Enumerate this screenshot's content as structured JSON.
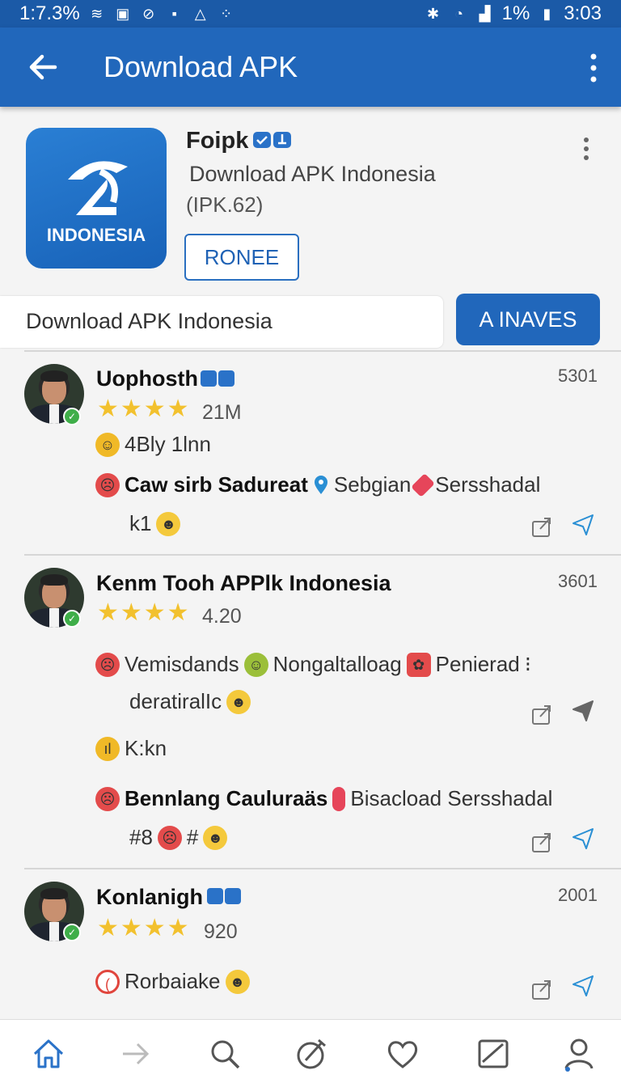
{
  "status_bar": {
    "left_text": "1:7.3%",
    "battery": "1%",
    "time": "3:03"
  },
  "app_bar": {
    "title": "Download APK"
  },
  "app_card": {
    "icon_label": "INDONESIA",
    "name": "Foipk",
    "subtitle": "Download APK Indonesia",
    "version": "(IPK.62)",
    "button_label": "RONEE"
  },
  "search": {
    "value": "Download APK Indonesia",
    "button_label": "A INAVES"
  },
  "posts": [
    {
      "name": "Uophosth",
      "count": "5301",
      "rating": "21M",
      "meta": "4Bly 1lnn",
      "line_bold": "Caw sirb Sadureat",
      "tag1": "Sebgian",
      "tag2": "Sersshadal",
      "reaction": "k1"
    },
    {
      "name": "Kenm Tooh APPlk Indonesia",
      "count": "3601",
      "rating": "4.20",
      "line1_a": "Vemisdands",
      "line1_b": "Nongaltalloag",
      "line1_c": "Penierad",
      "line2": "deratiralIc",
      "meta": "K:kn",
      "line3_bold": "Bennlang Cauluraäs",
      "line3_rest": "Bisacload Sersshadal",
      "reaction_a": "#8",
      "reaction_b": "#"
    },
    {
      "name": "Konlanigh",
      "count": "2001",
      "rating": "920",
      "meta": "Rorbaiake"
    }
  ],
  "colors": {
    "primary": "#2167bb",
    "status": "#1b5aa7",
    "star": "#f2c12e",
    "accent_icon": "#2a8fd4"
  }
}
